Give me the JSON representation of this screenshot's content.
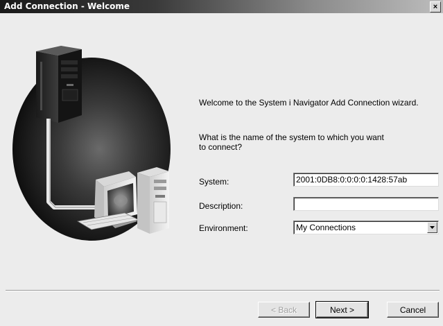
{
  "window": {
    "title": "Add Connection - Welcome",
    "close_glyph": "×"
  },
  "content": {
    "welcome_text": "Welcome to the System i Navigator Add Connection wizard.",
    "question_text": "What is the name of the system to which you want to connect?"
  },
  "form": {
    "system_label": "System:",
    "system_value": "2001:0DB8:0:0:0:0:1428:57ab",
    "description_label": "Description:",
    "description_value": "",
    "environment_label": "Environment:",
    "environment_value": "My Connections"
  },
  "buttons": {
    "back": "< Back",
    "next": "Next >",
    "cancel": "Cancel"
  },
  "icons": {
    "illustration": "server-to-workstation-illustration",
    "dropdown": "chevron-down-icon"
  }
}
